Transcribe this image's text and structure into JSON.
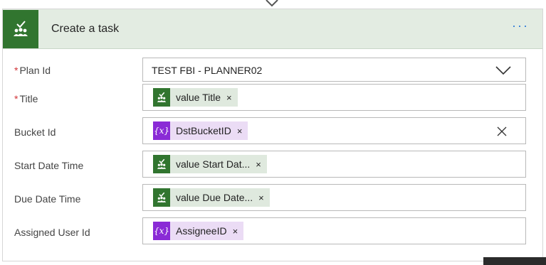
{
  "action": {
    "title": "Create a task",
    "more_label": "···"
  },
  "fields": {
    "plan_id": {
      "label": "Plan Id",
      "required": "*",
      "value": "TEST FBI - PLANNER02"
    },
    "title": {
      "label": "Title",
      "required": "*",
      "token": "value Title",
      "token_type": "planner"
    },
    "bucket_id": {
      "label": "Bucket Id",
      "token": "DstBucketID",
      "token_type": "variable"
    },
    "start_date_time": {
      "label": "Start Date Time",
      "token": "value Start Dat...",
      "token_type": "planner"
    },
    "due_date_time": {
      "label": "Due Date Time",
      "token": "value Due Date...",
      "token_type": "planner"
    },
    "assigned_user_id": {
      "label": "Assigned User Id",
      "token": "AssigneeID",
      "token_type": "variable"
    }
  },
  "glyphs": {
    "remove": "×",
    "variable_icon": "{x}"
  },
  "colors": {
    "planner_green": "#31752f",
    "header_bg": "#e3ece2",
    "variable_purple": "#8a2bd6",
    "required_red": "#d13438",
    "link_blue": "#2b79d6"
  }
}
